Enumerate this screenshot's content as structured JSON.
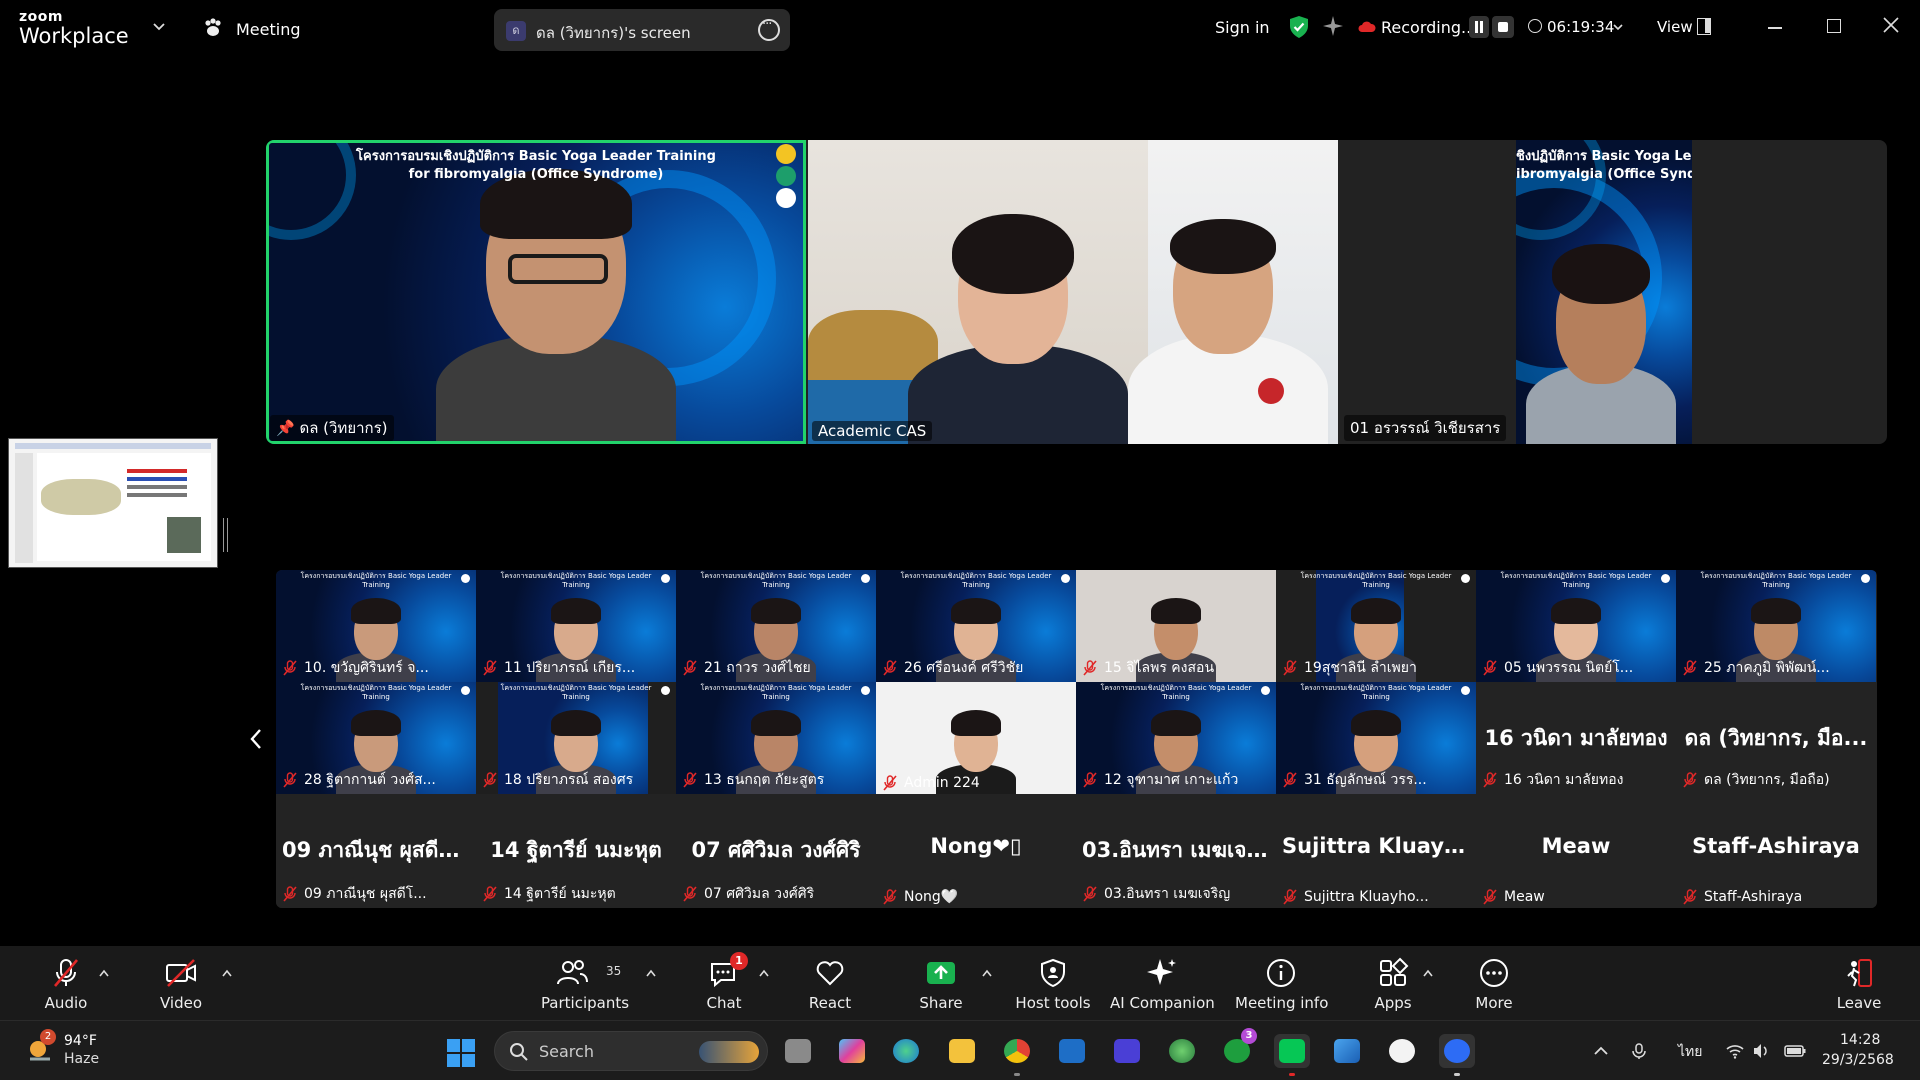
{
  "titlebar": {
    "brand_small": "zoom",
    "brand_large": "Workplace",
    "meeting_label": "Meeting",
    "screen_avatar_letter": "ด",
    "screen_share_label": "ดล (วิทยากร)'s screen",
    "sign_in": "Sign in",
    "recording_label": "Recording...",
    "timer": "06:19:34",
    "view_label": "View"
  },
  "speakers": {
    "banner_1": "โครงการอบรมเชิงปฏิบัติการ Basic Yoga Leader Training",
    "banner_2": "for fibromyalgia (Office Syndrome)",
    "banner_side_1": "ชิงปฏิบัติการ Basic Yoga Lea",
    "banner_side_2": "ibromyalgia (Office Syndro",
    "tiles": [
      {
        "name": "ดล (วิทยากร)"
      },
      {
        "name": "Academic CAS"
      },
      {
        "name": "01 อรวรรณ์ วิเชียรสาร"
      }
    ]
  },
  "gallery": {
    "tiles": [
      {
        "name": "10. ขวัญศิรินทร์ จ...",
        "big": ""
      },
      {
        "name": "11 ปริยาภรณ์ เกียร...",
        "big": ""
      },
      {
        "name": "21 ถาวร วงศ์ไชย",
        "big": ""
      },
      {
        "name": "26 ศรีอนงค์ ศรีวิชัย",
        "big": ""
      },
      {
        "name": "15 จิไลพร คงสอน",
        "big": ""
      },
      {
        "name": "19สุชาลินี ลำเพยา",
        "big": ""
      },
      {
        "name": "05 นพวรรณ นิตย์โ...",
        "big": ""
      },
      {
        "name": "25 ภาคภูมิ พิพัฒน์...",
        "big": ""
      },
      {
        "name": "28 ฐิตากานต์ วงศ์ส...",
        "big": ""
      },
      {
        "name": "18 ปริยาภรณ์ สองศร",
        "big": ""
      },
      {
        "name": "13 ธนกฤต กัยะสูตร",
        "big": ""
      },
      {
        "name": "Admin 224",
        "big": ""
      },
      {
        "name": "12 จุฑามาศ เกาะแก้ว",
        "big": ""
      },
      {
        "name": "31 ธัญลักษณ์ วรร...",
        "big": ""
      },
      {
        "name": "16 วนิดา มาลัยทอง",
        "big": "16 วนิดา มาลัยทอง"
      },
      {
        "name": "ดล (วิทยากร, มือถือ)",
        "big": "ดล (วิทยากร, มือ..."
      },
      {
        "name": "09 ภาณีนุช ผุสดีโ...",
        "big": "09 ภาณีนุช ผุสดีโ..."
      },
      {
        "name": "14 ฐิตารีย์ นมะหุต",
        "big": "14 ฐิตารีย์ นมะหุต"
      },
      {
        "name": "07 ศศิวิมล วงศ์ศิริ",
        "big": "07 ศศิวิมล วงศ์ศิริ"
      },
      {
        "name": "Nong🤍",
        "big": "Nong❤▯"
      },
      {
        "name": "03.อินทรา เมฆเจริญ",
        "big": "03.อินทรา เมฆเจ..."
      },
      {
        "name": "Sujittra Kluayho...",
        "big": "Sujittra  Kluayho..."
      },
      {
        "name": "Meaw",
        "big": "Meaw"
      },
      {
        "name": "Staff-Ashiraya",
        "big": "Staff-Ashiraya"
      }
    ]
  },
  "toolbar": {
    "audio": "Audio",
    "video": "Video",
    "participants": "Participants",
    "participants_count": "35",
    "chat": "Chat",
    "chat_badge": "1",
    "react": "React",
    "share": "Share",
    "host_tools": "Host tools",
    "ai_companion": "AI Companion",
    "meeting_info": "Meeting info",
    "apps": "Apps",
    "more": "More",
    "leave": "Leave"
  },
  "taskbar": {
    "weather_badge": "2",
    "temperature": "94°F",
    "weather": "Haze",
    "search": "Search",
    "xbox_badge": "3",
    "language": "ไทย",
    "time": "14:28",
    "date": "29/3/2568"
  },
  "colors": {
    "active_speaker_border": "#22d36b",
    "share_green": "#19b14f",
    "recording_red": "#e02828",
    "mic_off_red": "#e02828"
  }
}
